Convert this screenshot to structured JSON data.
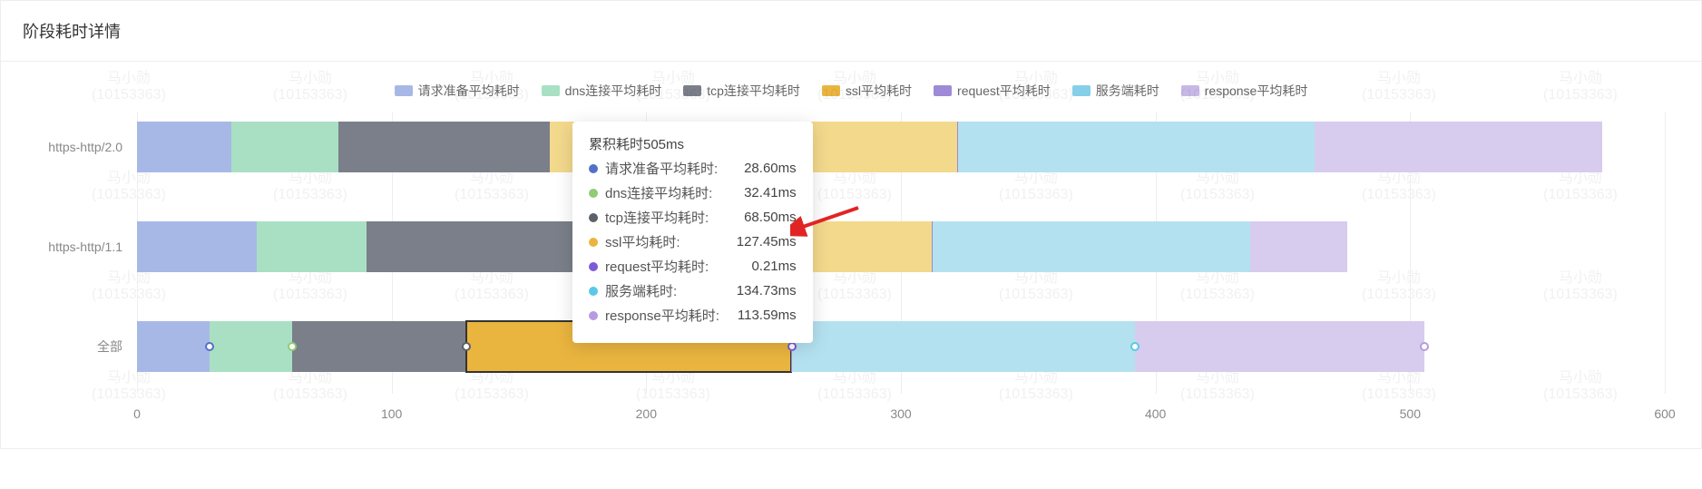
{
  "title": "阶段耗时详情",
  "watermark": {
    "name": "马小勋",
    "id": "(10153363)"
  },
  "legend": [
    {
      "key": "prep",
      "label": "请求准备平均耗时",
      "color": "#a8b8e6"
    },
    {
      "key": "dns",
      "label": "dns连接平均耗时",
      "color": "#a9e0c4"
    },
    {
      "key": "tcp",
      "label": "tcp连接平均耗时",
      "color": "#7b7f8a"
    },
    {
      "key": "ssl",
      "label": "ssl平均耗时",
      "color": "#eab53f"
    },
    {
      "key": "request",
      "label": "request平均耗时",
      "color": "#9e8ad6"
    },
    {
      "key": "server",
      "label": "服务端耗时",
      "color": "#86cfe8"
    },
    {
      "key": "response",
      "label": "response平均耗时",
      "color": "#c7b8e6"
    }
  ],
  "x_axis": {
    "min": 0,
    "max": 600,
    "ticks": [
      0,
      100,
      200,
      300,
      400,
      500,
      600
    ]
  },
  "rows": [
    {
      "key": "http2",
      "label": "https-http/2.0"
    },
    {
      "key": "http11",
      "label": "https-http/1.1"
    },
    {
      "key": "all",
      "label": "全部"
    }
  ],
  "tooltip": {
    "title": "累积耗时505ms",
    "items": [
      {
        "label": "请求准备平均耗时:",
        "value": "28.60ms",
        "color": "#5470c6"
      },
      {
        "label": "dns连接平均耗时:",
        "value": "32.41ms",
        "color": "#91cc75"
      },
      {
        "label": "tcp连接平均耗时:",
        "value": "68.50ms",
        "color": "#5b6168"
      },
      {
        "label": "ssl平均耗时:",
        "value": "127.45ms",
        "color": "#eab53f"
      },
      {
        "label": "request平均耗时:",
        "value": "0.21ms",
        "color": "#7b5cd6"
      },
      {
        "label": "服务端耗时:",
        "value": "134.73ms",
        "color": "#5ac8e8"
      },
      {
        "label": "response平均耗时:",
        "value": "113.59ms",
        "color": "#b69be0"
      }
    ]
  },
  "chart_data": {
    "type": "bar",
    "orientation": "horizontal-stacked",
    "xlabel": "",
    "ylabel": "",
    "xlim": [
      0,
      600
    ],
    "categories": [
      "https-http/2.0",
      "https-http/1.1",
      "全部"
    ],
    "series": [
      {
        "name": "请求准备平均耗时",
        "color": "#a8b8e6",
        "values": [
          37,
          47,
          28.6
        ]
      },
      {
        "name": "dns连接平均耗时",
        "color": "#a9e0c4",
        "values": [
          42,
          43,
          32.41
        ]
      },
      {
        "name": "tcp连接平均耗时",
        "color": "#7b7f8a",
        "values": [
          83,
          90,
          68.5
        ]
      },
      {
        "name": "ssl平均耗时",
        "color": "#f3d98c",
        "values": [
          160,
          132,
          127.45
        ]
      },
      {
        "name": "request平均耗时",
        "color": "#9e8ad6",
        "values": [
          0.3,
          0.3,
          0.21
        ]
      },
      {
        "name": "服务端耗时",
        "color": "#b4e1f0",
        "values": [
          140,
          125,
          134.73
        ]
      },
      {
        "name": "response平均耗时",
        "color": "#d7cbee",
        "values": [
          113,
          38,
          113.59
        ]
      }
    ],
    "highlight": {
      "row": 2,
      "series": "ssl平均耗时"
    },
    "markers_row": 2,
    "tooltip_summary": {
      "label": "累积耗时",
      "value": 505,
      "unit": "ms"
    }
  }
}
